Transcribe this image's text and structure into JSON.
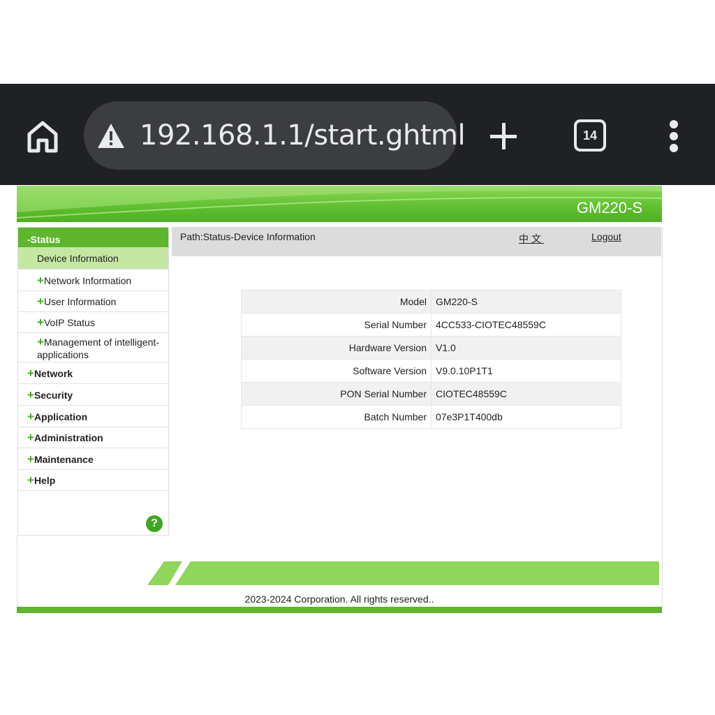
{
  "browser": {
    "url": "192.168.1.1/start.ghtml",
    "tab_count": "14",
    "colors": {
      "toolbar": "#202124",
      "omnibox": "#3c3d41",
      "text": "#e8eaed"
    }
  },
  "header": {
    "model": "GM220-S"
  },
  "sidebar": {
    "status_label": "-Status",
    "status_items": [
      {
        "label": "Device Information"
      },
      {
        "label": "Network Information"
      },
      {
        "label": "User Information"
      },
      {
        "label": "VoIP Status"
      },
      {
        "label": "Management of intelligent-applications"
      }
    ],
    "sections": [
      {
        "label": "Network"
      },
      {
        "label": "Security"
      },
      {
        "label": "Application"
      },
      {
        "label": "Administration"
      },
      {
        "label": "Maintenance"
      },
      {
        "label": "Help"
      }
    ],
    "help_icon_text": "?"
  },
  "content": {
    "path": "Path:Status-Device Information",
    "language_link": "中文",
    "logout_link": "Logout",
    "rows": [
      {
        "label": "Model",
        "value": "GM220-S"
      },
      {
        "label": "Serial Number",
        "value": "4CC533-CIOTEC48559C"
      },
      {
        "label": "Hardware Version",
        "value": "V1.0"
      },
      {
        "label": "Software Version",
        "value": "V9.0.10P1T1"
      },
      {
        "label": "PON Serial Number",
        "value": "CIOTEC48559C"
      },
      {
        "label": "Batch Number",
        "value": "07e3P1T400db"
      }
    ]
  },
  "footer": {
    "copyright": "2023-2024 Corporation. All rights reserved.."
  },
  "theme": {
    "accent_green": "#5fb52d",
    "active_item_bg": "#c5e7a4",
    "path_bar_bg": "#dcdcdc"
  }
}
